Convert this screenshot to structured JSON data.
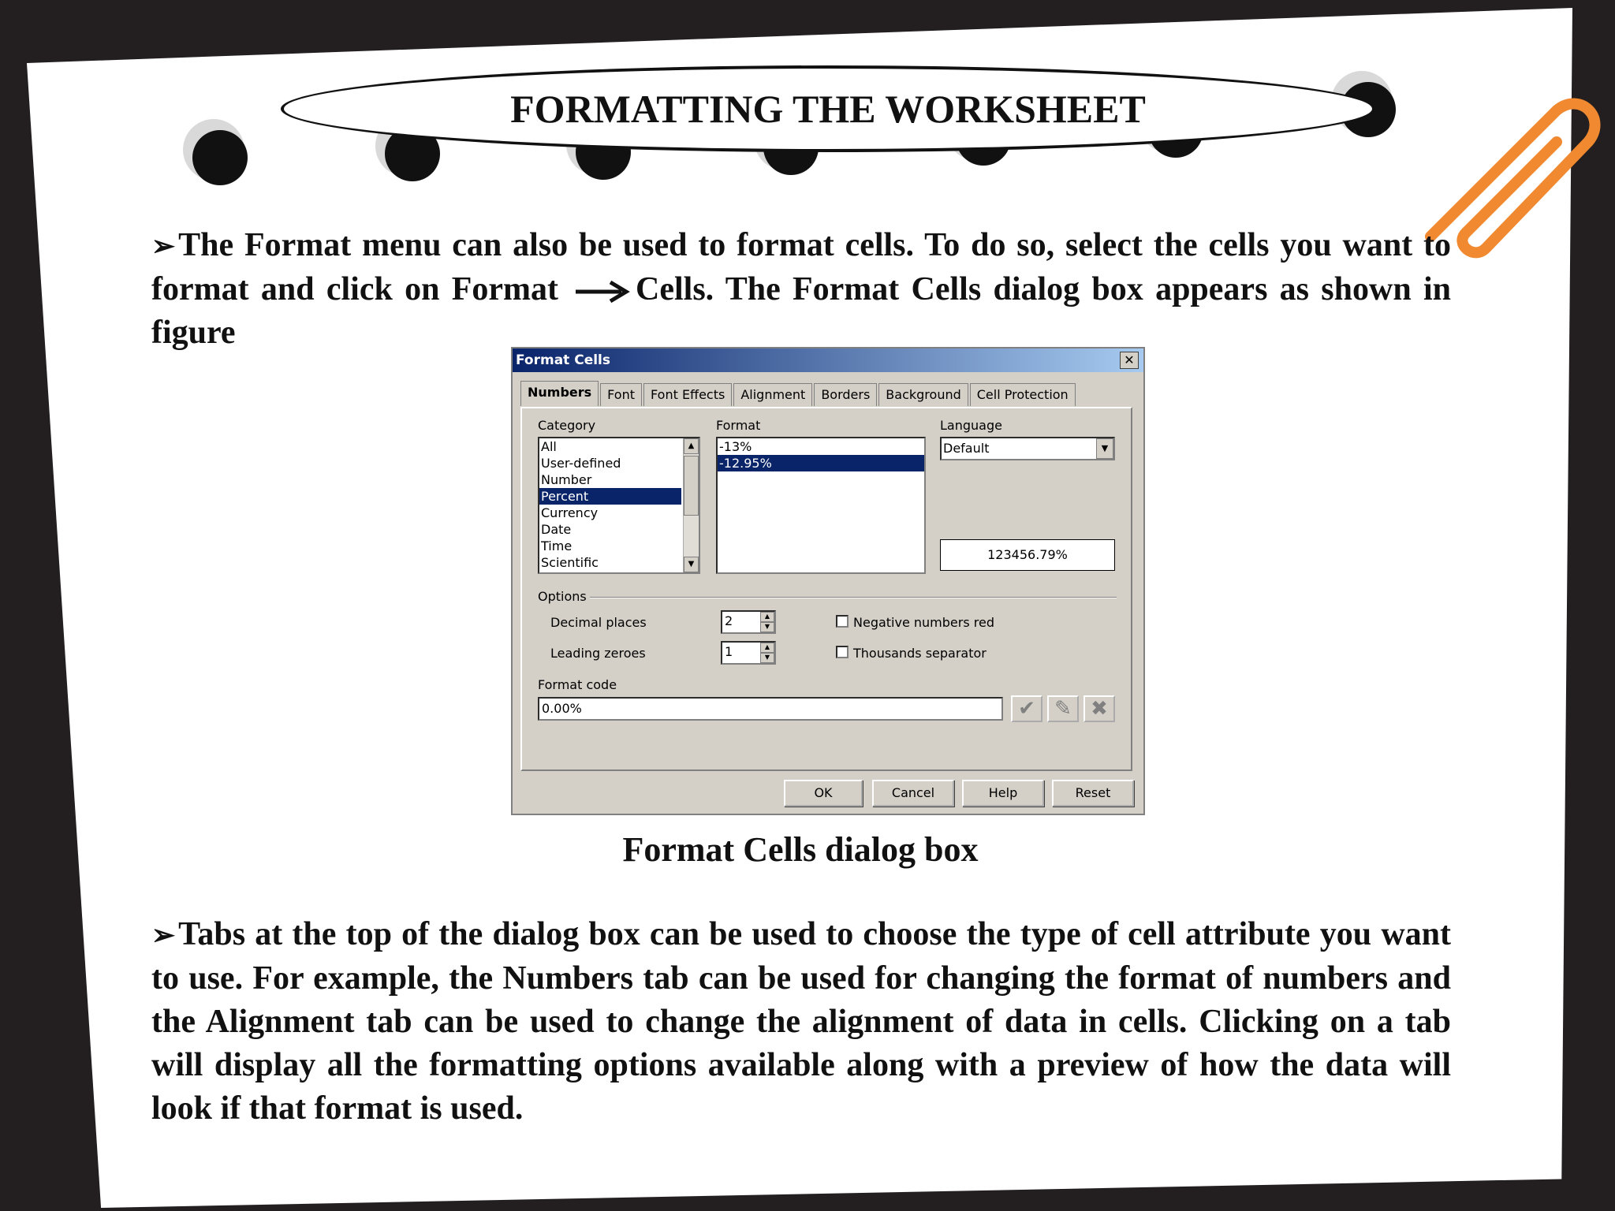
{
  "slide": {
    "title": "FORMATTING THE WORKSHEET",
    "para1_a": "The Format menu can also be used to format cells. To do so, select the cells you want to format and click on Format",
    "para1_b": "Cells. The Format Cells dialog box appears as shown in figure",
    "caption": "Format Cells dialog box",
    "para2": "Tabs at the top of the dialog box can be used to choose the type of cell attribute you want to use. For example, the Numbers tab can be used for changing the format of numbers and the Alignment tab can be used to change the alignment of data in cells. Clicking on a tab will display all the formatting options available along with a preview of how the data will look if that format is used.",
    "bullet_glyph": "➢"
  },
  "dialog": {
    "title": "Format Cells",
    "close_glyph": "✕",
    "tabs": [
      "Numbers",
      "Font",
      "Font Effects",
      "Alignment",
      "Borders",
      "Background",
      "Cell Protection"
    ],
    "category_label": "Category",
    "categories": [
      "All",
      "User-defined",
      "Number",
      "Percent",
      "Currency",
      "Date",
      "Time",
      "Scientific"
    ],
    "selected_category": "Percent",
    "format_label": "Format",
    "formats": [
      "-13%",
      "-12.95%"
    ],
    "selected_format": "-12.95%",
    "language_label": "Language",
    "language_value": "Default",
    "preview_value": "123456.79%",
    "options_label": "Options",
    "decimal_places_label": "Decimal places",
    "decimal_places_value": "2",
    "leading_zeroes_label": "Leading zeroes",
    "leading_zeroes_value": "1",
    "negative_red_label": "Negative numbers red",
    "thousands_sep_label": "Thousands separator",
    "format_code_label": "Format code",
    "format_code_value": "0.00%",
    "buttons": {
      "ok": "OK",
      "cancel": "Cancel",
      "help": "Help",
      "reset": "Reset"
    },
    "icons": {
      "accept": "✔",
      "comment": "✎",
      "delete": "✖"
    }
  },
  "colors": {
    "selection": "#0a246a",
    "dialog_bg": "#d4d0c8",
    "clip": "#f0892f"
  }
}
